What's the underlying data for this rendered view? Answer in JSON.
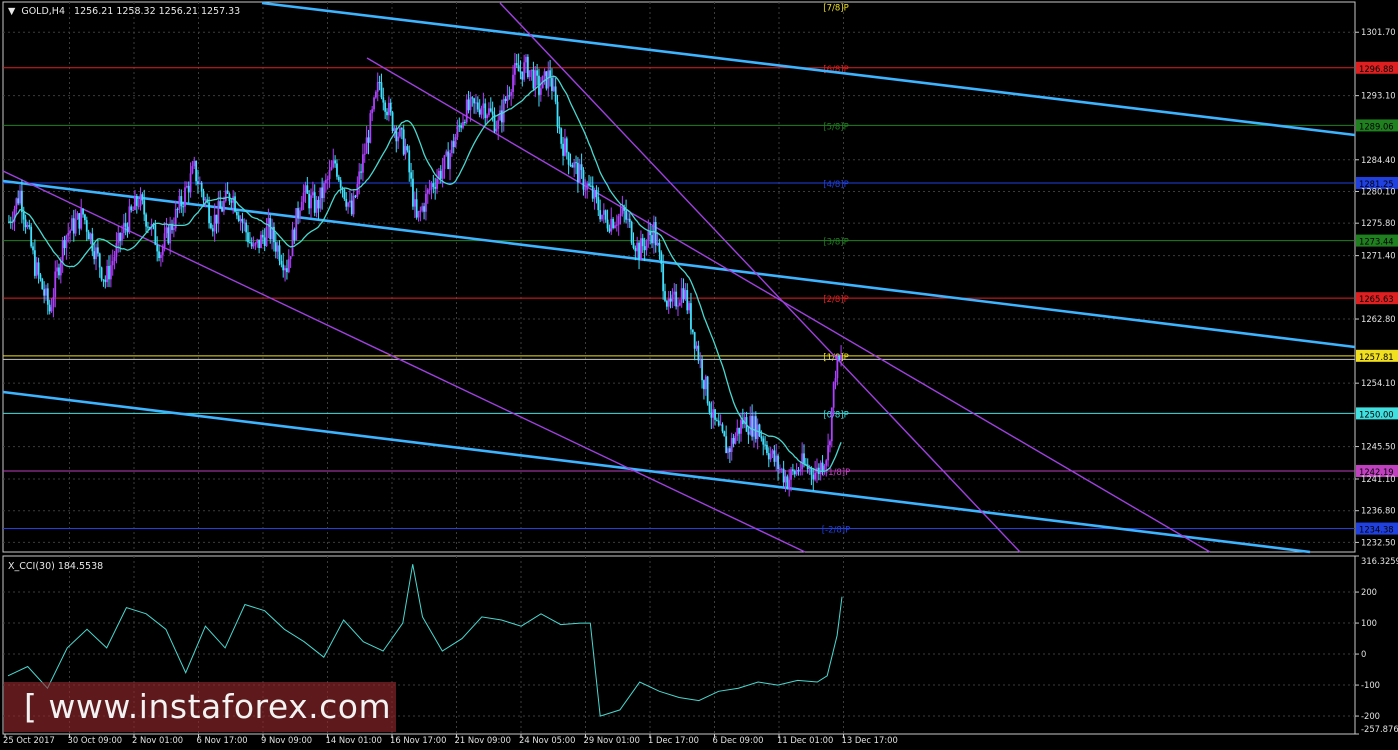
{
  "chart_data": [
    {
      "type": "line",
      "title": "GOLD,H4",
      "ohlc": "1256.21 1258.32 1256.21 1257.33",
      "ylim": [
        1231.2,
        1305.8
      ],
      "x_ticks": [
        "25 Oct 2017",
        "30 Oct 09:00",
        "2 Nov 01:00",
        "6 Nov 17:00",
        "9 Nov 09:00",
        "14 Nov 01:00",
        "16 Nov 17:00",
        "21 Nov 09:00",
        "24 Nov 05:00",
        "29 Nov 01:00",
        "1 Dec 17:00",
        "6 Dec 09:00",
        "11 Dec 01:00",
        "13 Dec 17:00"
      ],
      "y_ticks": [
        "1301.70",
        "1293.10",
        "1284.40",
        "1280.10",
        "1275.80",
        "1271.40",
        "1262.80",
        "1254.10",
        "1245.50",
        "1241.10",
        "1236.80",
        "1232.50"
      ],
      "y_tick_values": [
        1301.7,
        1293.1,
        1284.4,
        1280.1,
        1275.8,
        1271.4,
        1262.8,
        1254.1,
        1245.5,
        1241.1,
        1236.8,
        1232.5
      ],
      "murrey_levels": [
        {
          "label": "[7/8]P",
          "value": 1305.2,
          "price_tag": "",
          "color": "#f0e020"
        },
        {
          "label": "[6/8]P",
          "value": 1296.88,
          "price_tag": "1296.88",
          "color": "#e02020"
        },
        {
          "label": "[5/8]P",
          "value": 1289.06,
          "price_tag": "1289.06",
          "color": "#208020"
        },
        {
          "label": "[4/8]P",
          "value": 1281.25,
          "price_tag": "1281.25",
          "color": "#2040e0"
        },
        {
          "label": "[3/8]P",
          "value": 1273.44,
          "price_tag": "1273.44",
          "color": "#208020"
        },
        {
          "label": "[2/8]P",
          "value": 1265.63,
          "price_tag": "1265.63",
          "color": "#e02020"
        },
        {
          "label": "[1/8]P",
          "value": 1257.81,
          "price_tag": "1257.81",
          "color": "#f0e020"
        },
        {
          "label": "[0/8]P",
          "value": 1250.0,
          "price_tag": "1250.00",
          "color": "#40e0e0"
        },
        {
          "label": "[-1/8]P",
          "value": 1242.19,
          "price_tag": "1242.19",
          "color": "#c040c0"
        },
        {
          "label": "[-2/8]P",
          "value": 1234.38,
          "price_tag": "1234.38",
          "color": "#2040e0"
        }
      ],
      "current_price": "1257.33",
      "colors": {
        "bull_candle": "#b040ff",
        "bear_candle": "#40e0ff",
        "moving_average": "#48d8d0",
        "wide_channel": "#3cb4ff",
        "narrow_channel": "#a040e0",
        "grid": "#3c3c3c"
      }
    },
    {
      "type": "line",
      "title": "X_CCI(30) 184.5538",
      "ylim": [
        -257.8763,
        316.3259
      ],
      "y_ticks": [
        "316.3259",
        "200",
        "100",
        "0",
        "-100",
        "-200",
        "-257.8763"
      ],
      "y_tick_values": [
        316.3259,
        200,
        100,
        0,
        -100,
        -200,
        -257.8763
      ],
      "series": [
        {
          "x": [
            0,
            20,
            40,
            60,
            80,
            100,
            120,
            140,
            160,
            180,
            200,
            220,
            240,
            260,
            280,
            300,
            320,
            340,
            360,
            380,
            400,
            410,
            420,
            440,
            460,
            480,
            500,
            520,
            540,
            560,
            580,
            590,
            600,
            620,
            640,
            660,
            680,
            700,
            720,
            740,
            760,
            780,
            800,
            820,
            830,
            840,
            845
          ],
          "values": [
            -70,
            -40,
            -110,
            20,
            80,
            20,
            150,
            130,
            80,
            -60,
            90,
            20,
            160,
            140,
            80,
            40,
            -10,
            110,
            40,
            10,
            100,
            290,
            120,
            10,
            50,
            120,
            110,
            90,
            130,
            95,
            100,
            100,
            -200,
            -180,
            -90,
            -120,
            -140,
            -150,
            -120,
            -110,
            -90,
            -100,
            -85,
            -90,
            -70,
            60,
            185
          ]
        }
      ]
    }
  ],
  "watermark": "[ www.instaforex.com ]"
}
